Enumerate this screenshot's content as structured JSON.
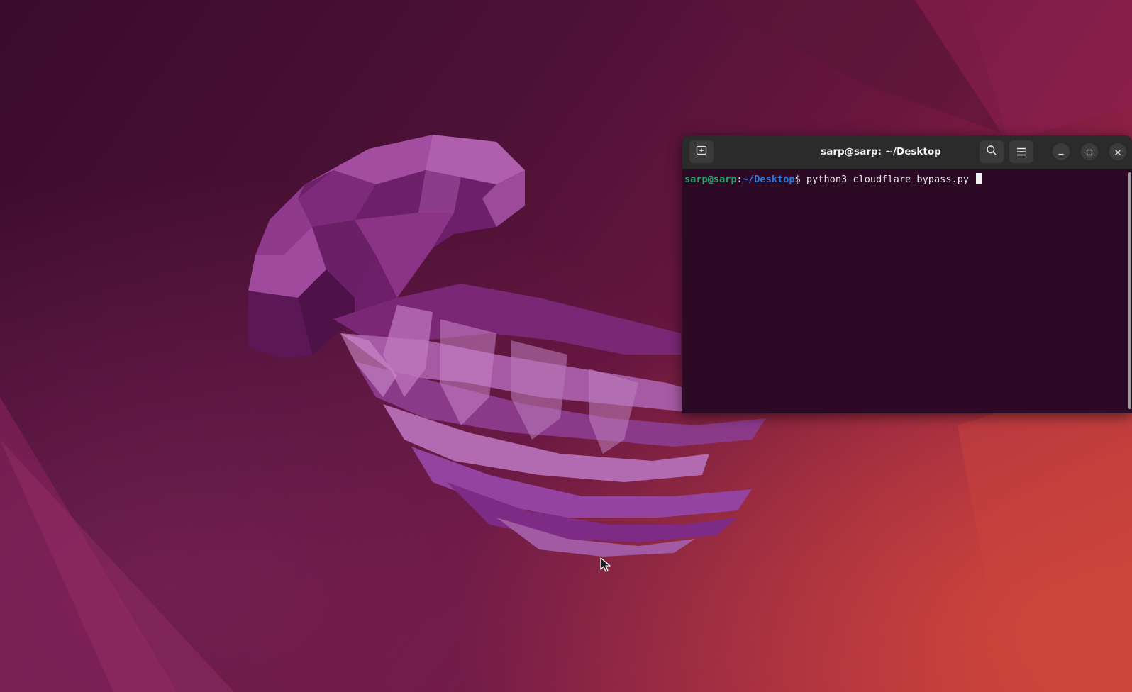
{
  "desktop": {
    "wallpaper": "ubuntu-jellyfish-wallpaper",
    "colors": {
      "background_dark": "#3a0b2c",
      "background_mid": "#6a163f",
      "background_warm": "#c83f3a",
      "jellyfish_light": "#b865b0",
      "jellyfish_mid": "#8a3585",
      "jellyfish_dark": "#5b1756"
    }
  },
  "terminal": {
    "title": "sarp@sarp: ~/Desktop",
    "new_tab_icon": "new-tab-icon",
    "search_icon": "search-icon",
    "menu_icon": "hamburger-menu-icon",
    "minimize_icon": "minimize-icon",
    "maximize_icon": "maximize-icon",
    "close_icon": "close-icon",
    "prompt": {
      "user_host": "sarp@sarp",
      "colon": ":",
      "path": "~/Desktop",
      "dollar": "$ ",
      "command": "python3 cloudflare_bypass.py "
    },
    "colors": {
      "titlebar": "#2b2b2b",
      "body": "#2c0a26",
      "prompt_user": "#26a269",
      "prompt_path": "#2a7bde",
      "text": "#e8e8e8"
    }
  }
}
